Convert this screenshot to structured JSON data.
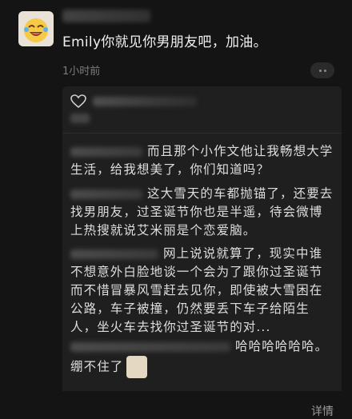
{
  "post": {
    "text": "Emily你就见你男朋友吧，加油。",
    "time": "1小时前"
  },
  "comments": [
    {
      "text": "而且那个小作文他让我畅想大学生活，给我想美了，你们知道吗？"
    },
    {
      "text": "这大雪天的车都抛锚了，还要去找男朋友，过圣诞节你也是半遥，待会微博上热搜就说艾米丽是个恋爱脑。"
    },
    {
      "text": "网上说说就算了，现实中谁不想意外白脸地谈一个会为了跟你过圣诞节而不惜冒暴风雪赶去见你，即使被大雪困在公路，车子被撞，仍然要丢下车子给陌生人，坐火车去找你过圣诞节的对..."
    },
    {
      "text": "哈哈哈哈哈哈。",
      "text2": "绷不住了"
    }
  ],
  "expand_label": "详情"
}
